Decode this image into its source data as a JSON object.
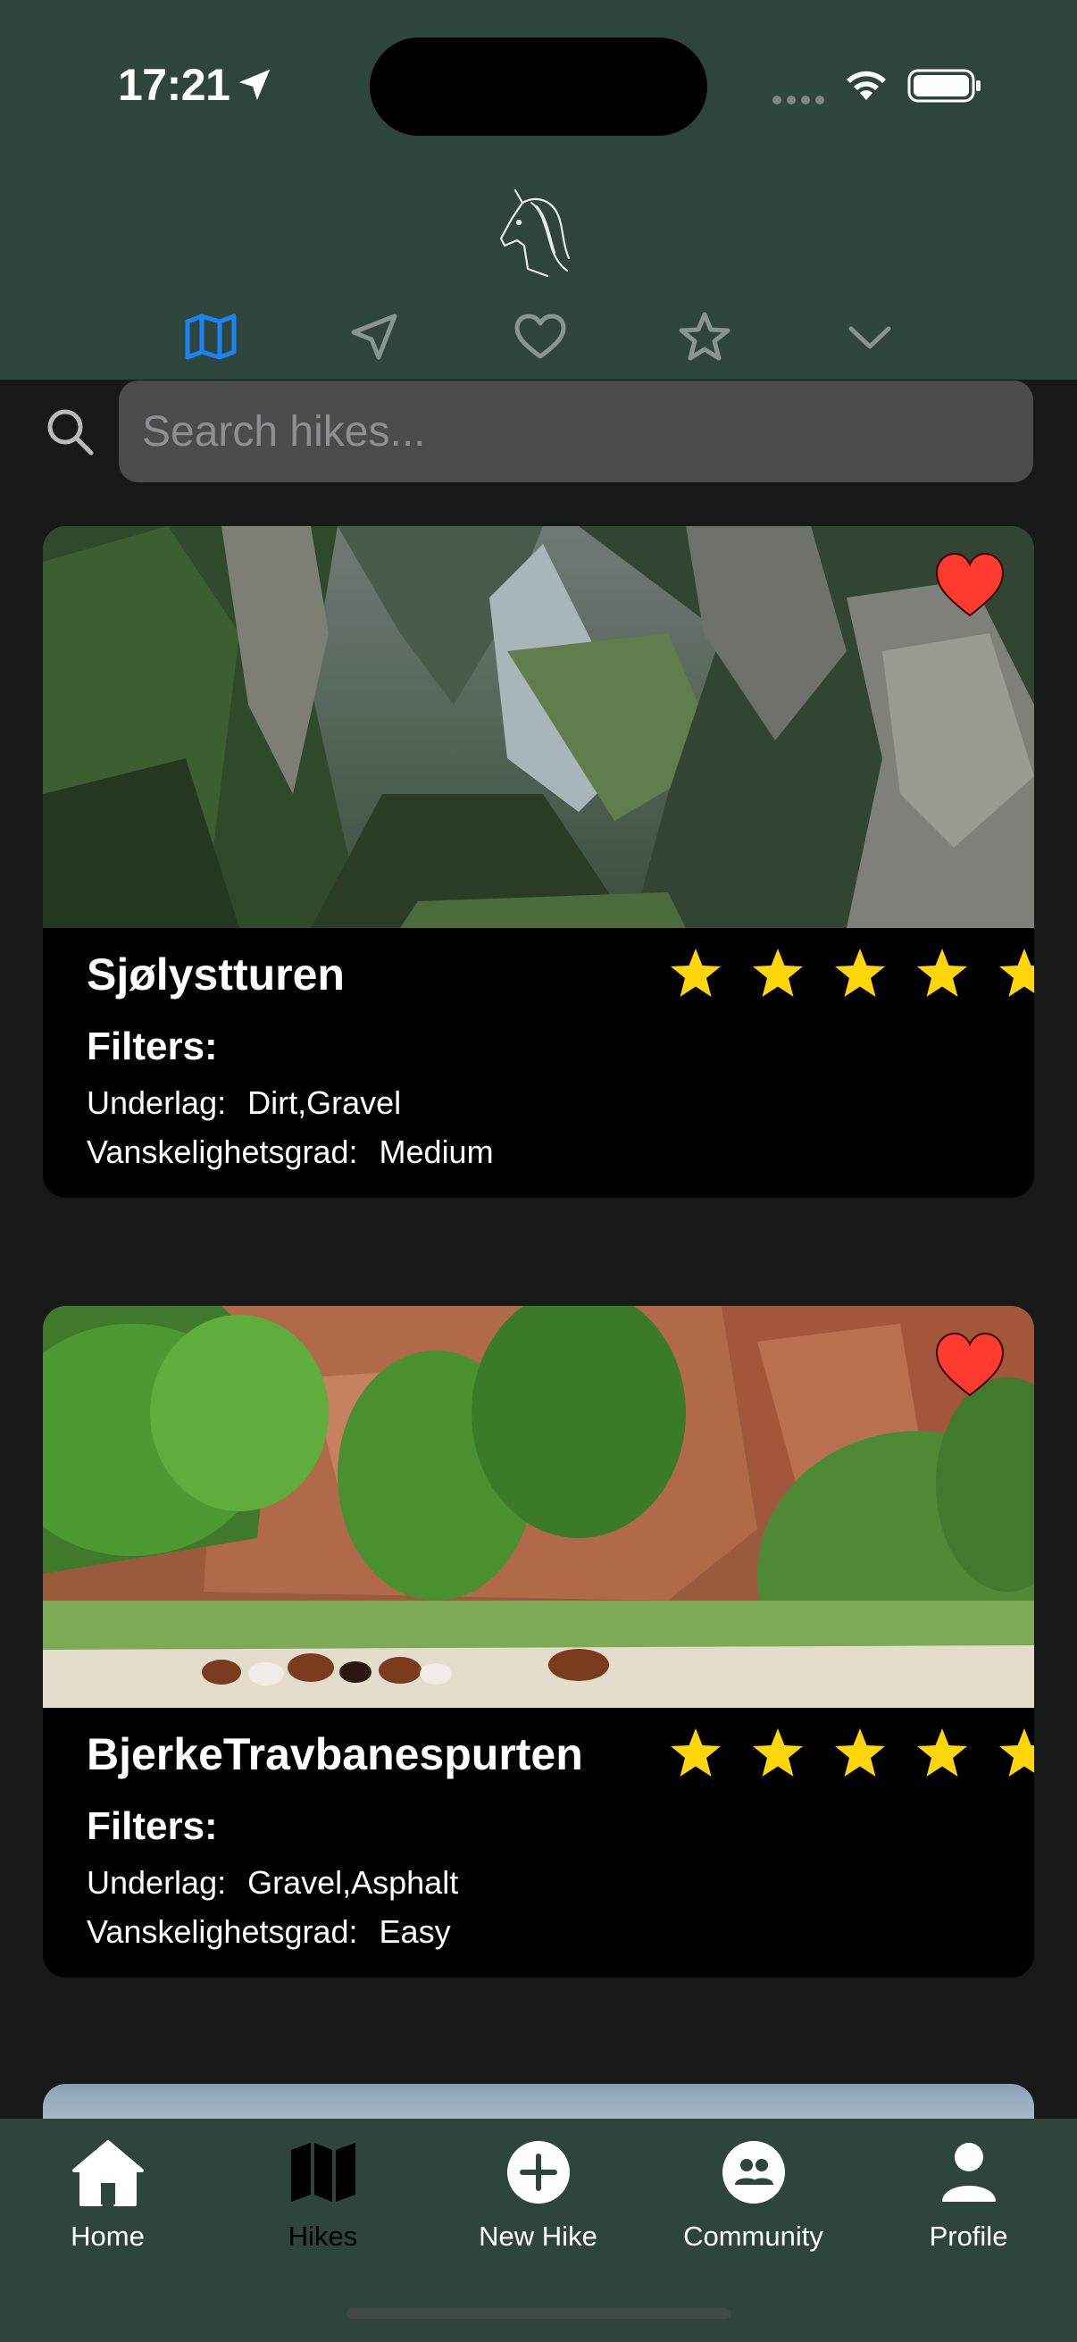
{
  "status_bar": {
    "time": "17:21"
  },
  "search": {
    "placeholder": "Search hikes..."
  },
  "hikes": [
    {
      "name": "Sjølystturen",
      "rating": 5,
      "filters_label": "Filters:",
      "underlag_label": "Underlag:",
      "underlag_value": "Dirt,Gravel",
      "difficulty_label": "Vanskelighetsgrad:",
      "difficulty_value": "Medium",
      "favorite": true
    },
    {
      "name": "BjerkeTravbanespurten",
      "rating": 5,
      "filters_label": "Filters:",
      "underlag_label": "Underlag:",
      "underlag_value": "Gravel,Asphalt",
      "difficulty_label": "Vanskelighetsgrad:",
      "difficulty_value": "Easy",
      "favorite": true
    }
  ],
  "tabbar": {
    "items": [
      {
        "label": "Home",
        "icon": "house-icon"
      },
      {
        "label": "Hikes",
        "icon": "map-icon"
      },
      {
        "label": "New Hike",
        "icon": "plus-circle-icon"
      },
      {
        "label": "Community",
        "icon": "people-icon"
      },
      {
        "label": "Profile",
        "icon": "person-icon"
      }
    ]
  },
  "colors": {
    "header_bg": "#2e453c",
    "accent_blue": "#1a84f5",
    "star_yellow": "#ffd60a",
    "heart_red": "#ff3b30"
  }
}
